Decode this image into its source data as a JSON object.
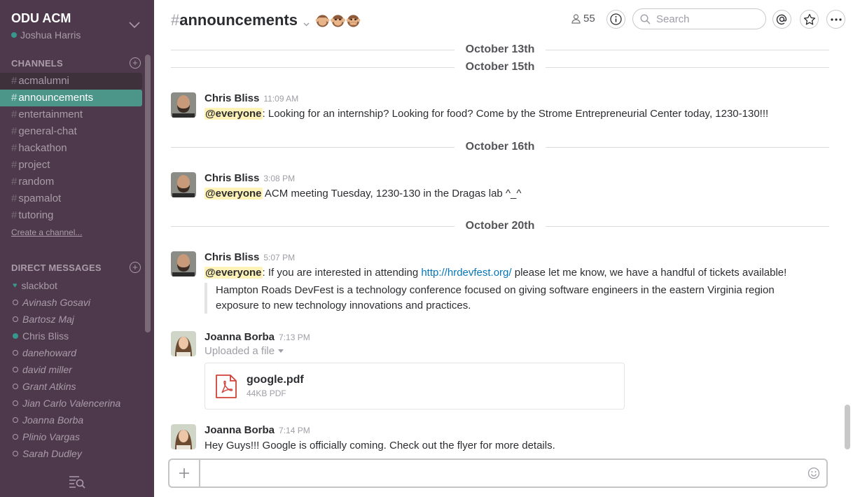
{
  "team": {
    "name": "ODU ACM",
    "user": "Joshua Harris"
  },
  "sidebar": {
    "channels_heading": "CHANNELS",
    "channels": [
      {
        "name": "acmalumni",
        "state": "hover"
      },
      {
        "name": "announcements",
        "state": "active"
      },
      {
        "name": "entertainment",
        "state": ""
      },
      {
        "name": "general-chat",
        "state": ""
      },
      {
        "name": "hackathon",
        "state": ""
      },
      {
        "name": "project",
        "state": ""
      },
      {
        "name": "random",
        "state": ""
      },
      {
        "name": "spamalot",
        "state": ""
      },
      {
        "name": "tutoring",
        "state": ""
      }
    ],
    "create_channel": "Create a channel...",
    "dm_heading": "DIRECT MESSAGES",
    "dms": [
      {
        "name": "slackbot",
        "status": "bot"
      },
      {
        "name": "Avinash Gosavi",
        "status": "away"
      },
      {
        "name": "Bartosz Maj",
        "status": "away"
      },
      {
        "name": "Chris Bliss",
        "status": "online"
      },
      {
        "name": "danehoward",
        "status": "away"
      },
      {
        "name": "david miller",
        "status": "away"
      },
      {
        "name": "Grant Atkins",
        "status": "away"
      },
      {
        "name": "Jian Carlo Valencerina",
        "status": "away"
      },
      {
        "name": "Joanna Borba",
        "status": "away"
      },
      {
        "name": "Plinio Vargas",
        "status": "away"
      },
      {
        "name": "Sarah Dudley",
        "status": "away"
      }
    ]
  },
  "header": {
    "channel_name": "announcements",
    "hash": "#",
    "member_count": "55",
    "search_placeholder": "Search"
  },
  "dividers": [
    "October 13th",
    "October 15th",
    "October 16th",
    "October 20th"
  ],
  "messages": [
    {
      "sender": "Chris Bliss",
      "time": "11:09 AM",
      "mention": "@everyone",
      "text": ": Looking for an internship? Looking for food? Come by the Strome Entrepreneurial Center today, 1230-130!!!"
    },
    {
      "sender": "Chris Bliss",
      "time": "3:08 PM",
      "mention": "@everyone",
      "text": " ACM meeting Tuesday,  1230-130 in the Dragas lab ^_^"
    },
    {
      "sender": "Chris Bliss",
      "time": "5:07 PM",
      "mention": "@everyone",
      "text_before": ": If you are interested in attending ",
      "link": "http://hrdevfest.org/",
      "text_after": " please let me know, we have a handful of tickets available!",
      "attachment": "Hampton Roads DevFest is a technology conference focused on giving software engineers in the eastern Virginia region exposure to new technology innovations and practices."
    },
    {
      "sender": "Joanna Borba",
      "time": "7:13 PM",
      "upload_label": "Uploaded a file",
      "file_name": "google.pdf",
      "file_meta": "44KB PDF"
    },
    {
      "sender": "Joanna Borba",
      "time": "7:14 PM",
      "text": "Hey Guys!!! Google is officially coming.  Check out the flyer for more details."
    }
  ],
  "composer": {
    "placeholder": ""
  },
  "colors": {
    "sidebar": "#4d394b",
    "active_channel": "#4c9689",
    "mention_bg": "#fff3b8",
    "link": "#0576b9"
  }
}
